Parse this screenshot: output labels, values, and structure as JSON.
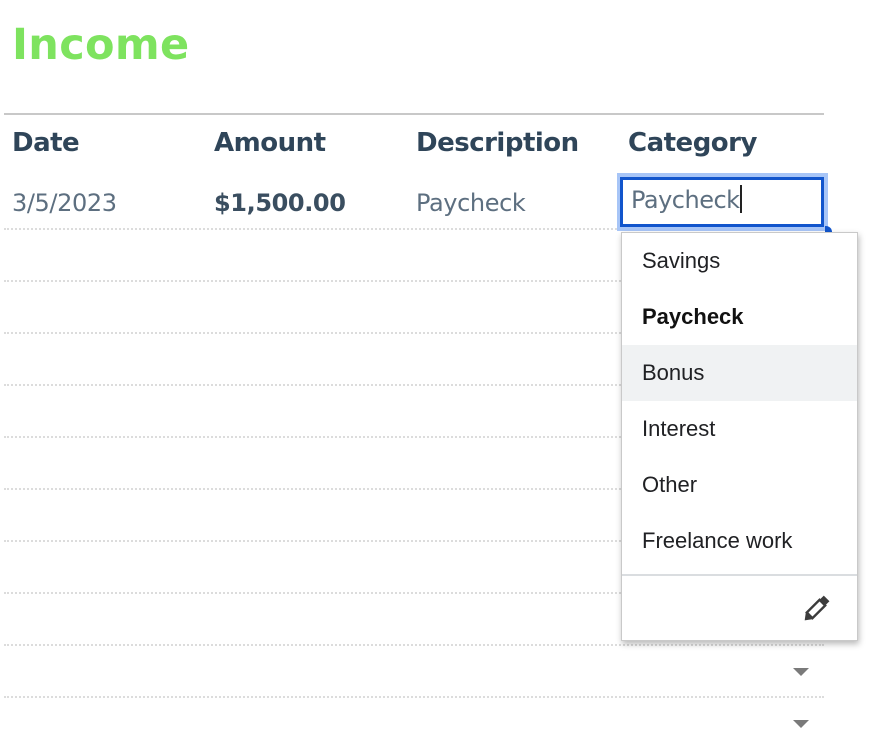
{
  "page": {
    "title": "Income"
  },
  "colors": {
    "title": "#7ee35f",
    "header_text": "#2f4559",
    "focus_border": "#1155cc",
    "focus_ring": "#a7c5f7",
    "hover_bg": "#f0f2f3"
  },
  "table": {
    "columns": [
      "Date",
      "Amount",
      "Description",
      "Category"
    ],
    "rows": [
      {
        "date": "3/5/2023",
        "amount": "$1,500.00",
        "description": "Paycheck",
        "category": "Paycheck"
      }
    ],
    "empty_rows": 9
  },
  "category_editor": {
    "value": "Paycheck",
    "options": [
      {
        "label": "Savings",
        "state": "normal"
      },
      {
        "label": "Paycheck",
        "state": "selected"
      },
      {
        "label": "Bonus",
        "state": "hover"
      },
      {
        "label": "Interest",
        "state": "normal"
      },
      {
        "label": "Other",
        "state": "normal"
      },
      {
        "label": "Freelance work",
        "state": "normal"
      }
    ],
    "footer_icon": "pencil-icon"
  },
  "row_dropdown_icon": "dropdown-arrow-icon"
}
